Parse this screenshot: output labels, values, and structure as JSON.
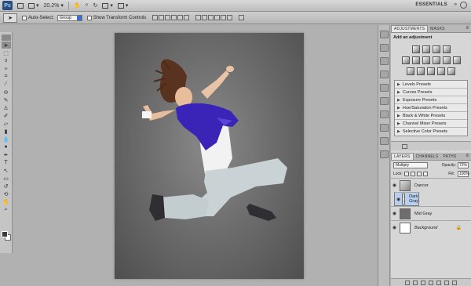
{
  "appbar": {
    "logo": "Ps",
    "zoom": "20.2%",
    "workspace": "ESSENTIALS"
  },
  "options": {
    "auto_select_label": "Auto-Select:",
    "auto_select_value": "Group",
    "show_transform_label": "Show Transform Controls"
  },
  "adjustments": {
    "tabs": [
      "ADJUSTMENTS",
      "MASKS"
    ],
    "title": "Add an adjustment",
    "presets": [
      "Levels Presets",
      "Curves Presets",
      "Exposure Presets",
      "Hue/Saturation Presets",
      "Black & White Presets",
      "Channel Mixer Presets",
      "Selective Color Presets"
    ]
  },
  "layers_panel": {
    "tabs": [
      "LAYERS",
      "CHANNELS",
      "PATHS"
    ],
    "blend_mode": "Multiply",
    "opacity_label": "Opacity:",
    "opacity_value": "72%",
    "lock_label": "Lock:",
    "fill_label": "Fill:",
    "fill_value": "100%",
    "layers": [
      {
        "name": "Dancer",
        "selected": false
      },
      {
        "name": "Dark Gray",
        "selected": true
      },
      {
        "name": "Mid Gray",
        "selected": false
      },
      {
        "name": "Background",
        "selected": false
      }
    ]
  },
  "colors": {
    "selected_layer": "#b8cfee",
    "panel_bg": "#d6d6d6",
    "workspace_bg": "#b1b1b1"
  }
}
